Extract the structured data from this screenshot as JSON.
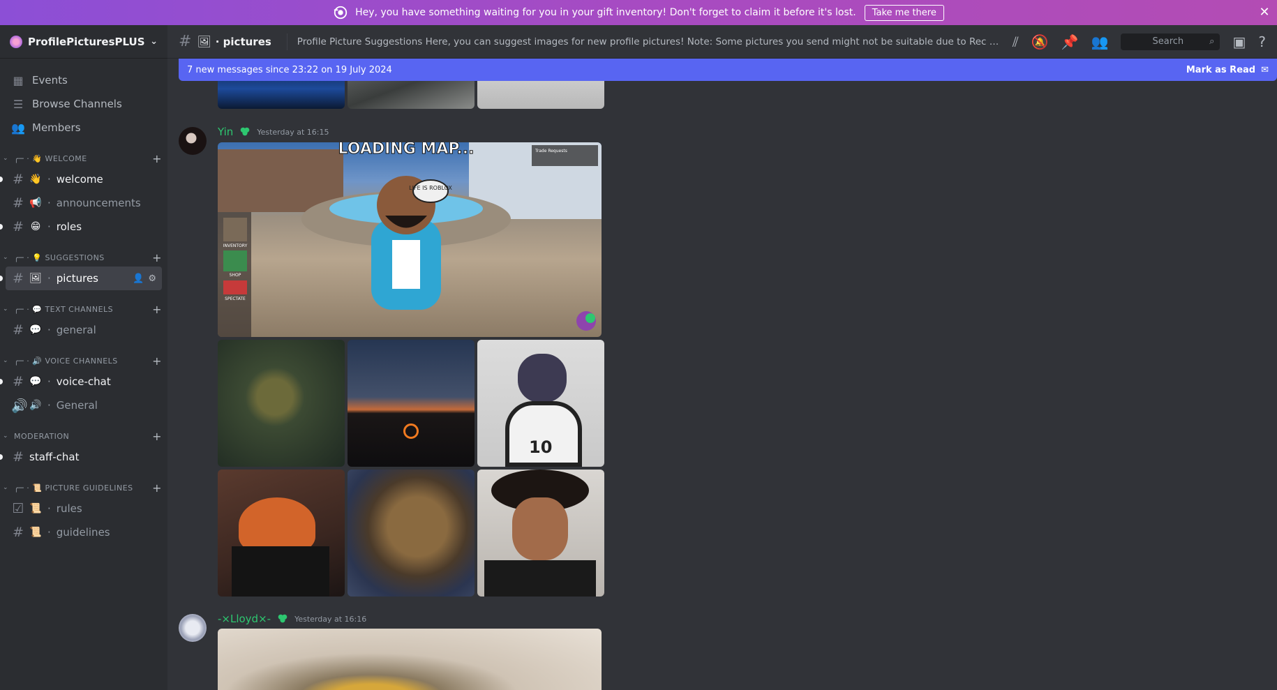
{
  "banner": {
    "text": "Hey, you have something waiting for you in your gift inventory! Don't forget to claim it before it's lost.",
    "cta": "Take me there",
    "close_glyph": "✕"
  },
  "guild": {
    "name": "ProfilePicturesPLUS",
    "chevron": "⌄"
  },
  "nav": [
    {
      "label": "Events",
      "icon": "calendar-icon"
    },
    {
      "label": "Browse Channels",
      "icon": "browse-icon"
    },
    {
      "label": "Members",
      "icon": "members-icon"
    }
  ],
  "categories": {
    "welcome": "WELCOME",
    "suggestions": "SUGGESTIONS",
    "text": "TEXT CHANNELS",
    "voice": "VOICE CHANNELS",
    "moderation": "MODERATION",
    "guidelines": "PICTURE GUIDELINES"
  },
  "channels": {
    "welcome": "welcome",
    "announcements": "announcements",
    "roles": "roles",
    "pictures": "pictures",
    "general": "general",
    "voice_chat": "voice-chat",
    "general_voice": "General",
    "staff_chat": "staff-chat",
    "rules": "rules",
    "guidelines": "guidelines"
  },
  "topbar": {
    "channel": "pictures",
    "topic": "Profile Picture Suggestions Here, you can suggest images for new profile pictures! Note: Some pictures you send might not be suitable due to Rec Room's Code of Conduct",
    "search_placeholder": "Search"
  },
  "new_messages": {
    "text": "7 new messages since 23:22 on 19 July 2024",
    "mark_read": "Mark as Read"
  },
  "messages": [
    {
      "author": "Yin",
      "timestamp": "Yesterday at 16:15",
      "color": "#2dc770"
    },
    {
      "author": "-×Lloyd×-",
      "timestamp": "Yesterday at 16:16",
      "color": "#2dc770"
    }
  ],
  "screenshot_text": {
    "loading": "LOADING MAP...",
    "bubble": "LIFE IS ROBLOX",
    "trade": "Trade Requests",
    "inventory": "INVENTORY",
    "shop": "SHOP",
    "spectate": "SPECTATE",
    "jersey": "10"
  },
  "colors": {
    "accent": "#5865f2",
    "online": "#2dc770",
    "sidebar": "#2b2d31",
    "main": "#313338"
  }
}
